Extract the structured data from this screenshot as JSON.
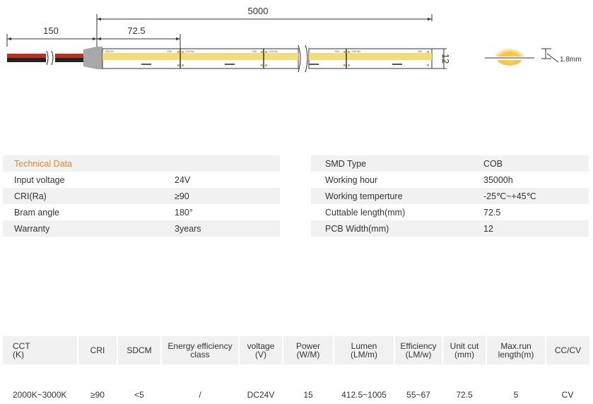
{
  "dimensions": {
    "total_length": "5000",
    "lead_length": "150",
    "cut_length": "72.5",
    "width": "12",
    "thickness": "1.8mm"
  },
  "strip_markings": {
    "plus": "+24",
    "label": "+24 Vo"
  },
  "colors": {
    "strip_yellow": "#f4dc7a",
    "wire_red": "#b8321f",
    "wire_black": "#222222",
    "connector_gray": "#a8a8a8",
    "accent_orange": "#e08a2c",
    "pad_orange": "#e0a86a"
  },
  "tech_left": {
    "heading": "Technical Data",
    "rows": [
      {
        "key": "Input voltage",
        "value": "24V"
      },
      {
        "key": "CRI(Ra)",
        "value": "≥90"
      },
      {
        "key": "Bram angle",
        "value": "180°"
      },
      {
        "key": "Warranty",
        "value": "3years"
      }
    ]
  },
  "tech_right": {
    "rows": [
      {
        "key": "SMD Type",
        "value": "COB"
      },
      {
        "key": "Working hour",
        "value": "35000h"
      },
      {
        "key": "Working temperture",
        "value": "-25℃~+45℃"
      },
      {
        "key": "Cuttable length(mm)",
        "value": "72.5"
      },
      {
        "key": "PCB Width(mm)",
        "value": "12"
      }
    ]
  },
  "product_table": {
    "headers": [
      [
        "CCT",
        "(K)"
      ],
      [
        "CRI"
      ],
      [
        "SDCM"
      ],
      [
        "Energy efficiency",
        "class"
      ],
      [
        "voltage",
        "(V)"
      ],
      [
        "Power",
        "(W/M)"
      ],
      [
        "Lumen",
        "(LM/m)"
      ],
      [
        "Efficiency",
        "(LM/w)"
      ],
      [
        "Unit cut",
        "(mm)"
      ],
      [
        "Max.run",
        "length(m)"
      ],
      [
        "CC/CV"
      ]
    ],
    "row": [
      "2000K~3000K",
      "≥90",
      "<5",
      "/",
      "DC24V",
      "15",
      "412.5~1005",
      "55~67",
      "72.5",
      "5",
      "CV"
    ]
  }
}
